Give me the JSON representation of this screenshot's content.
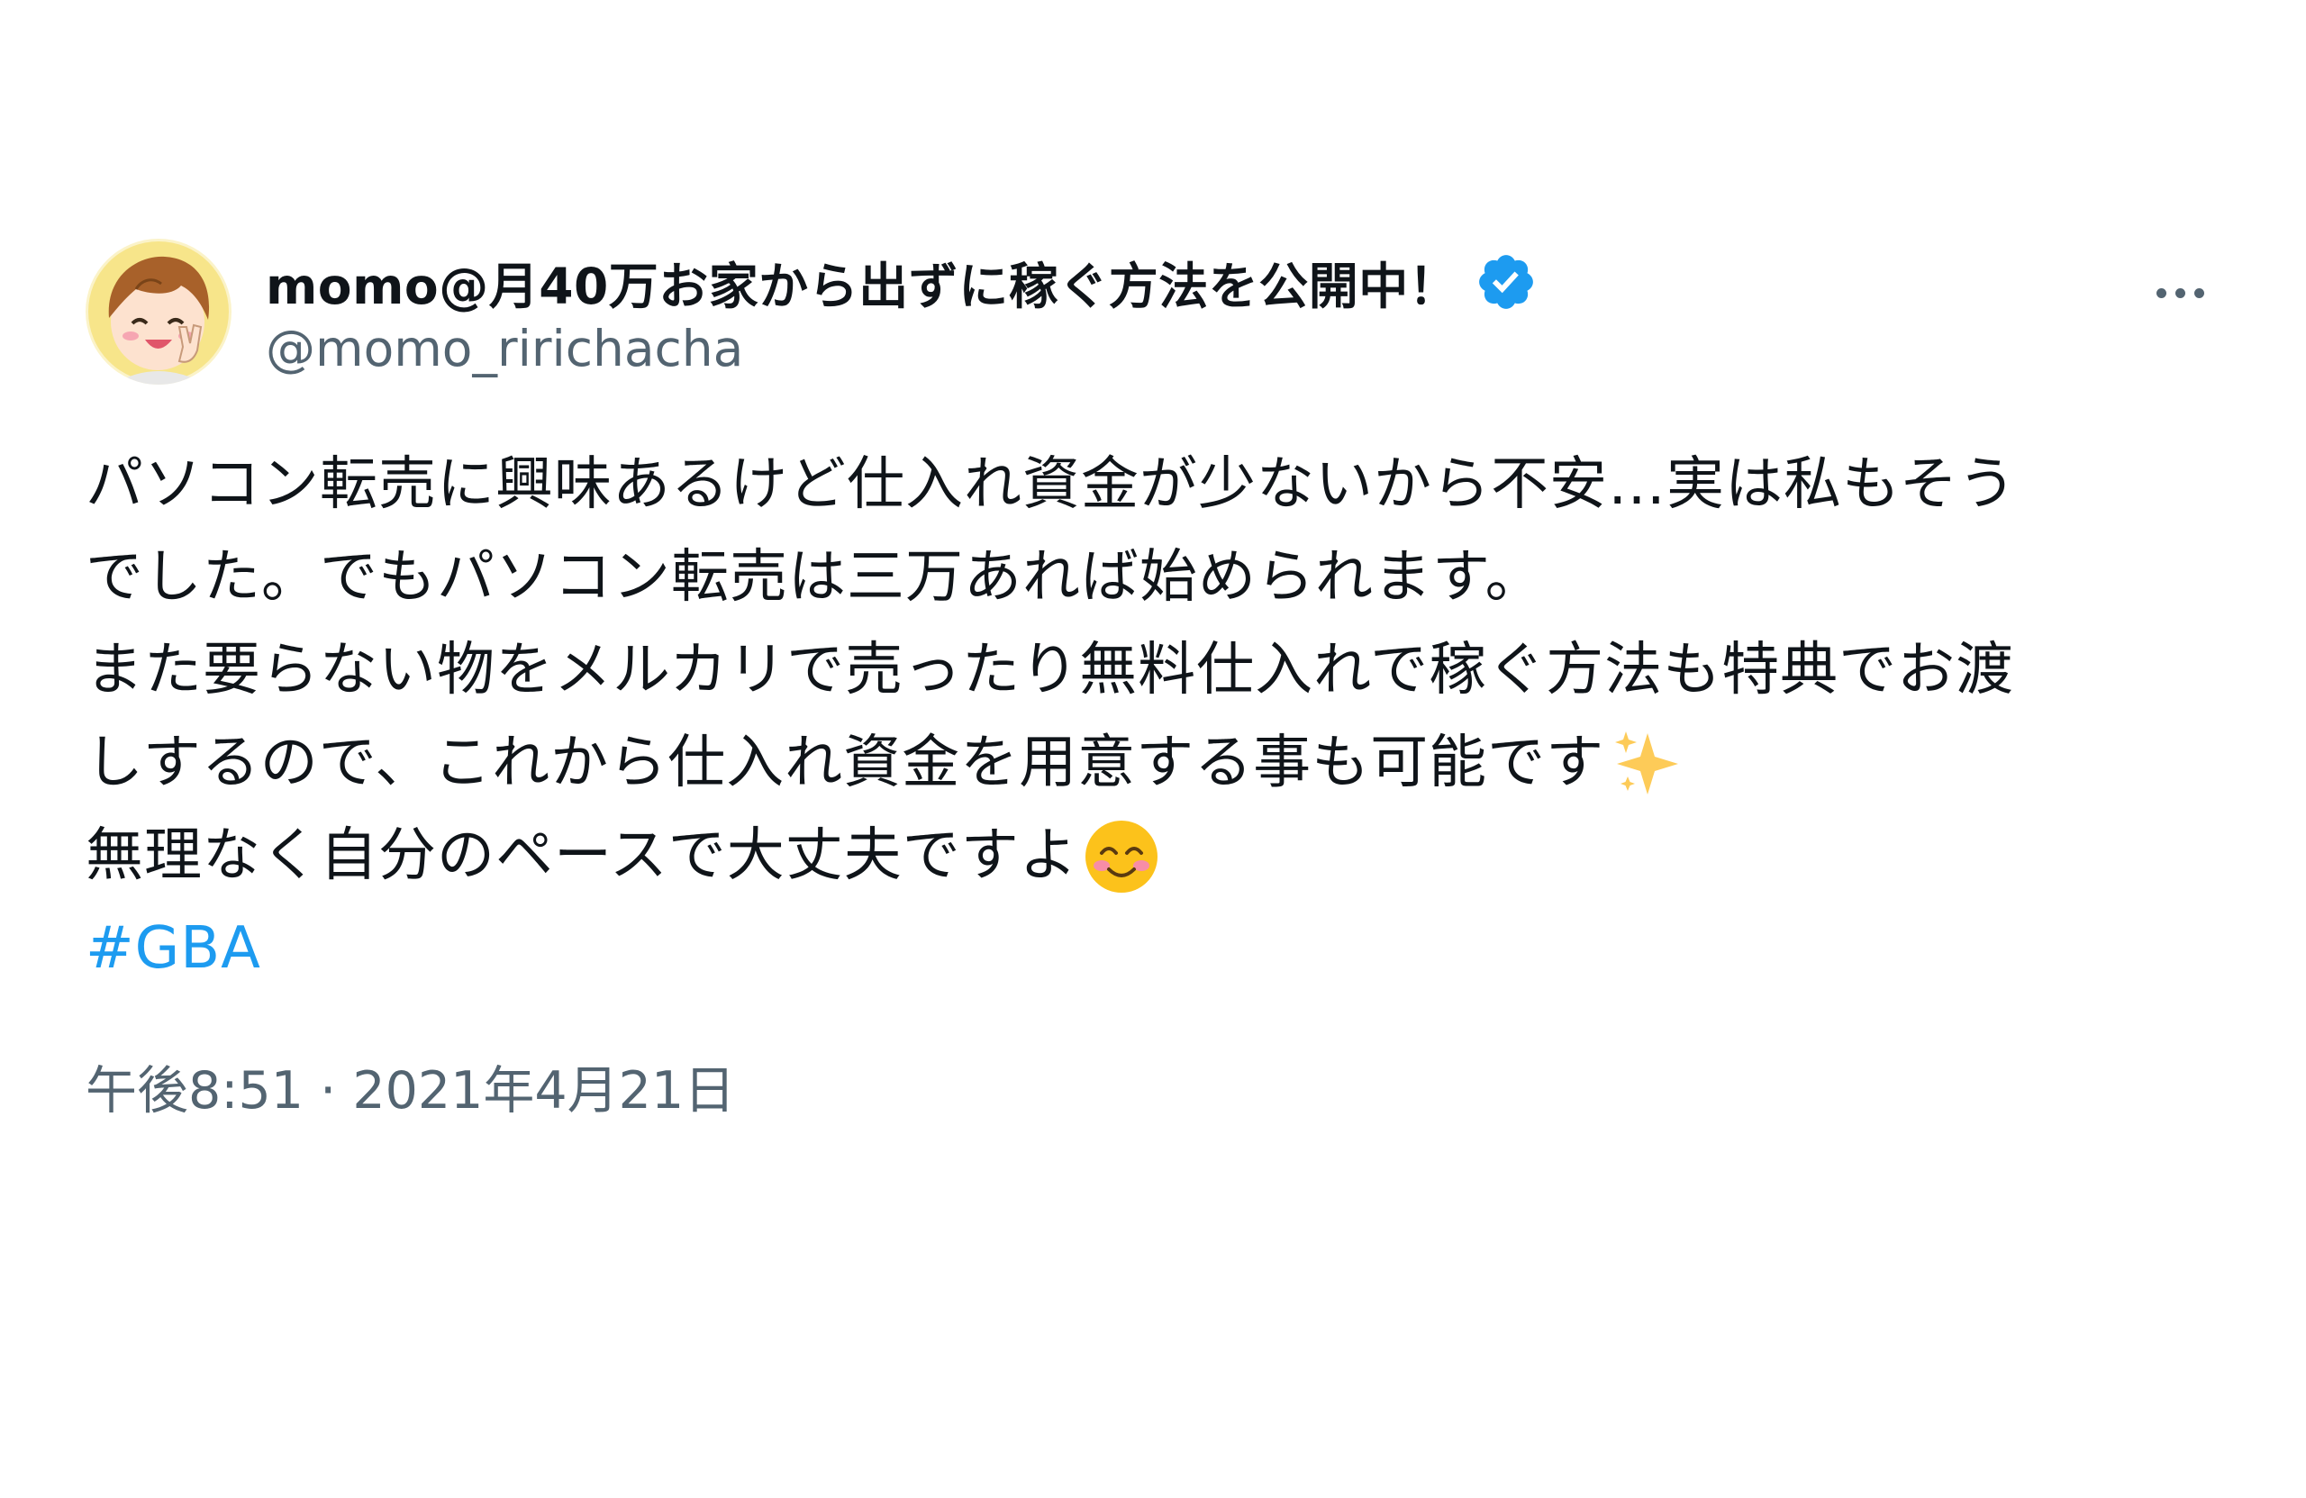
{
  "tweet": {
    "display_name": "momo@月40万お家から出ずに稼ぐ方法を公開中！",
    "handle": "@momo_ririchacha",
    "verified_icon": "verified-badge-icon",
    "more_icon": "more-options-icon",
    "avatar": "user-avatar",
    "body_lines": [
      "パソコン転売に興味あるけど仕入れ資金が少ないから不安…実は私もそう",
      "でした。でもパソコン転売は三万あれば始められます。",
      "また要らない物をメルカリで売ったり無料仕入れで稼ぐ方法も特典でお渡",
      "しするので、これから仕入れ資金を用意する事も可能です",
      "無理なく自分のペースで大丈夫ですよ"
    ],
    "sparkles_emoji": "sparkles-emoji",
    "smile_emoji": "smiling-face-emoji",
    "hashtag": "#GBA",
    "timestamp": "午後8:51 · 2021年4月21日"
  },
  "colors": {
    "text": "#0f1419",
    "secondary": "#536471",
    "link": "#1d9bf0",
    "verified": "#1d9bf0"
  }
}
